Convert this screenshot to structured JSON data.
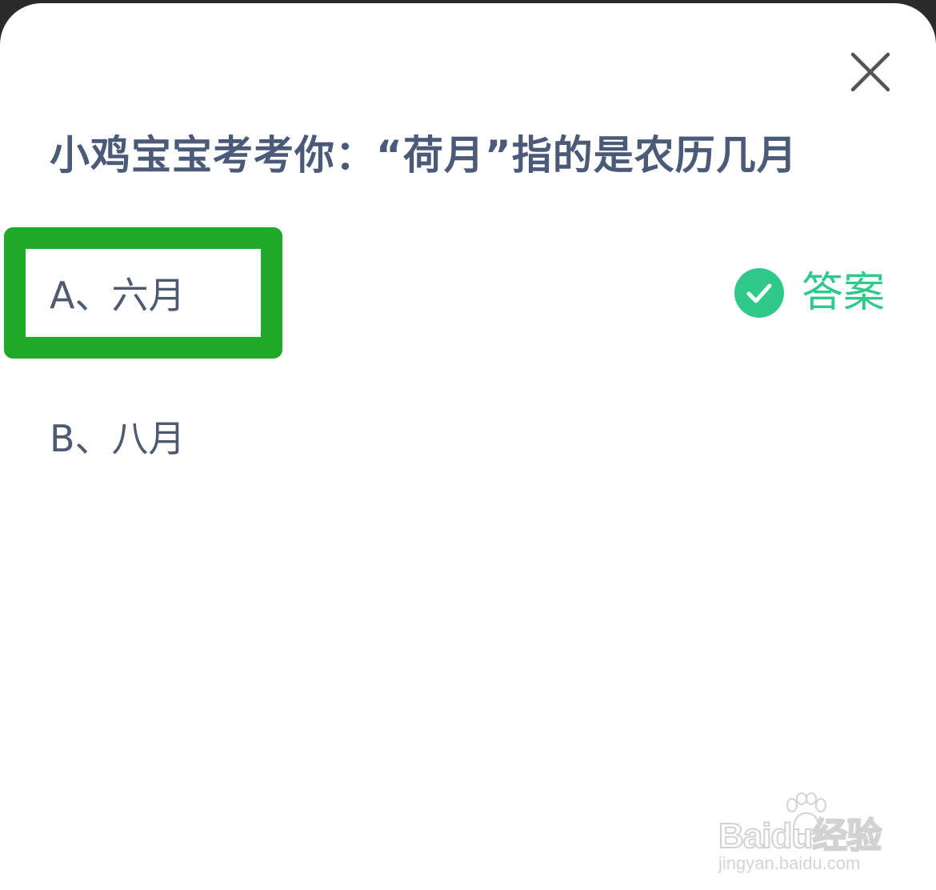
{
  "quiz": {
    "question": "小鸡宝宝考考你：“荷月”指的是农历几月",
    "options": [
      {
        "label": "A、六月",
        "is_answer": true,
        "highlighted": true
      },
      {
        "label": "B、八月",
        "is_answer": false,
        "highlighted": false
      }
    ],
    "answer_tag": "答案"
  },
  "icons": {
    "close": "close-icon",
    "answer": "check-circle-icon",
    "watermark_logo": "baidu-paw-icon"
  },
  "watermark": {
    "brand": "Baidu经验",
    "url": "jingyan.baidu.com"
  },
  "colors": {
    "highlight": "#1faa2a",
    "answer_green": "#2ec98b",
    "question_text": "#4b5a78",
    "option_text": "#4d5a70",
    "sheet_background": "#ffffff",
    "backdrop": "#2b2b2b"
  }
}
